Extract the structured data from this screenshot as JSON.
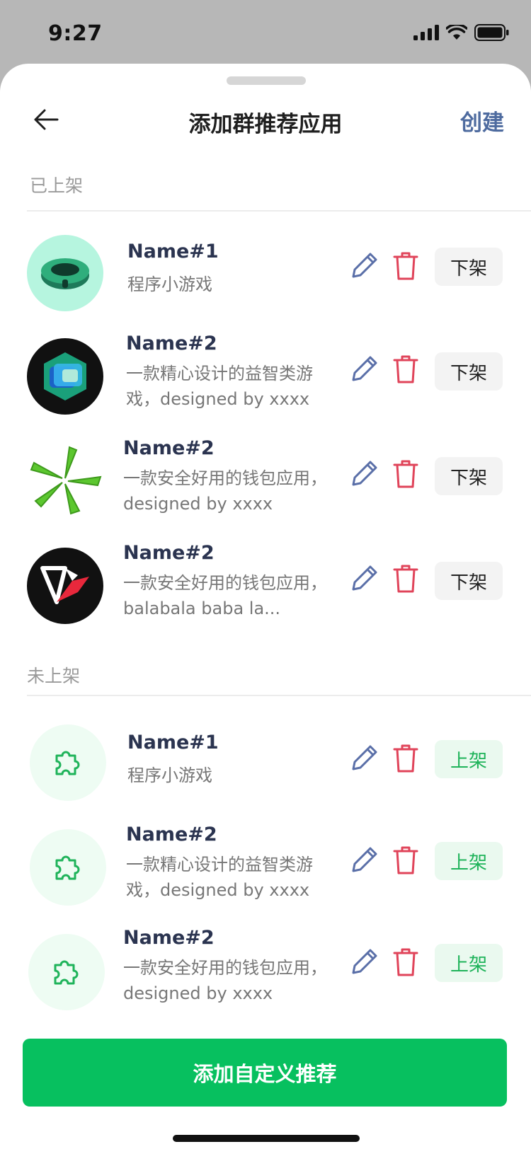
{
  "status": {
    "time": "9:27"
  },
  "nav": {
    "title": "添加群推荐应用",
    "action": "创建"
  },
  "sections": {
    "listed_label": "已上架",
    "unlisted_label": "未上架"
  },
  "listed_items": [
    {
      "name": "Name#1",
      "desc": "程序小游戏",
      "action": "下架",
      "icon": "stadium-icon"
    },
    {
      "name": "Name#2",
      "desc": "一款精心设计的益智类游戏，designed by xxxx",
      "action": "下架",
      "icon": "cube-app-icon"
    },
    {
      "name": "Name#2",
      "desc": "一款安全好用的钱包应用，designed by xxxx",
      "action": "下架",
      "icon": "green-star-icon"
    },
    {
      "name": "Name#2",
      "desc": "一款安全好用的钱包应用，balabala baba la...",
      "action": "下架",
      "icon": "v-logo-icon"
    }
  ],
  "unlisted_items": [
    {
      "name": "Name#1",
      "desc": "程序小游戏",
      "action": "上架",
      "icon": "puzzle-icon"
    },
    {
      "name": "Name#2",
      "desc": "一款精心设计的益智类游戏，designed by xxxx",
      "action": "上架",
      "icon": "puzzle-icon"
    },
    {
      "name": "Name#2",
      "desc": "一款安全好用的钱包应用，designed by xxxx",
      "action": "上架",
      "icon": "puzzle-icon"
    }
  ],
  "footer": {
    "button": "添加自定义推荐"
  },
  "colors": {
    "primary": "#07c05f",
    "link": "#4e6b9f",
    "edit_icon": "#5a6fa8",
    "delete_icon": "#e0445a"
  }
}
